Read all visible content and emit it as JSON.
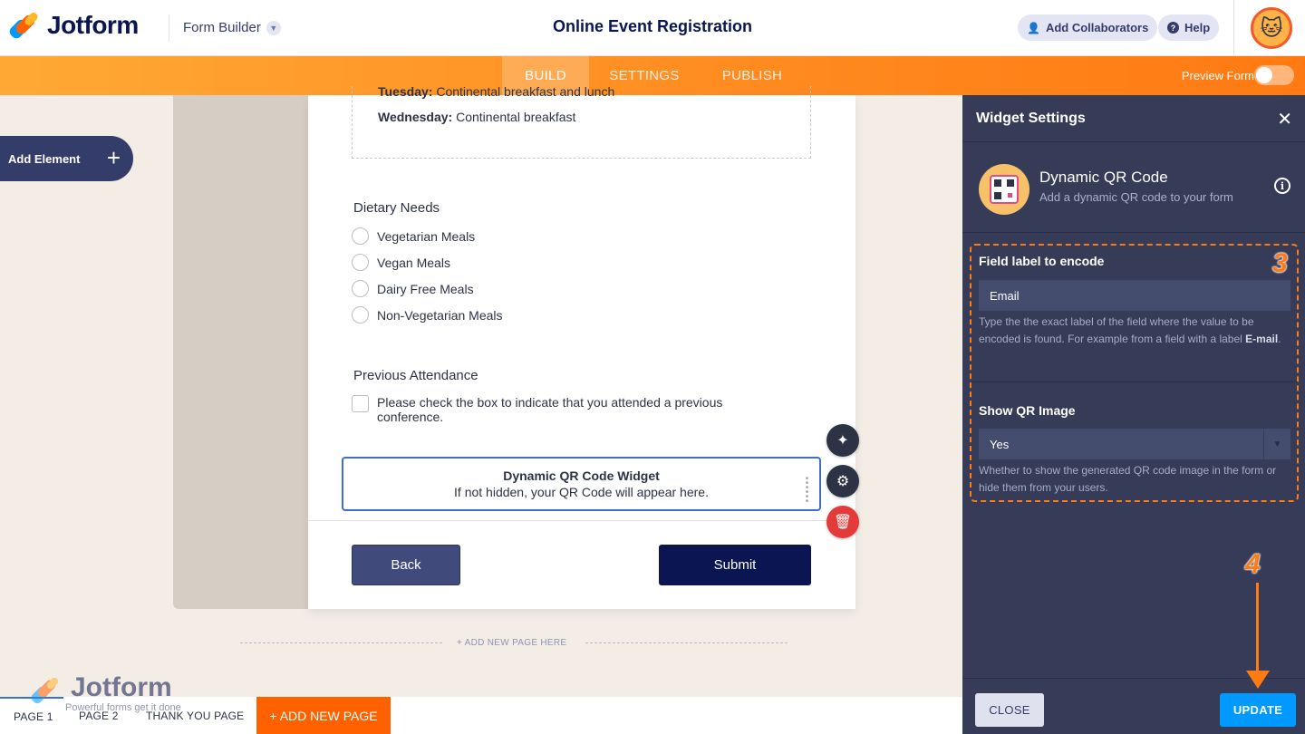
{
  "header": {
    "brand": "Jotform",
    "builder_label": "Form Builder",
    "page_title": "Online Event Registration",
    "add_collaborators": "Add Collaborators",
    "help": "Help"
  },
  "nav": {
    "tabs": [
      {
        "label": "BUILD",
        "active": true
      },
      {
        "label": "SETTINGS",
        "active": false
      },
      {
        "label": "PUBLISH",
        "active": false
      }
    ],
    "preview_label": "Preview Form",
    "preview_on": false
  },
  "sidebar": {
    "add_element": "Add Element"
  },
  "form": {
    "meals": [
      {
        "day": "Tuesday:",
        "text": "Continental breakfast and lunch"
      },
      {
        "day": "Wednesday:",
        "text": "Continental breakfast"
      }
    ],
    "dietary": {
      "label": "Dietary Needs",
      "options": [
        "Vegetarian Meals",
        "Vegan Meals",
        "Dairy Free Meals",
        "Non-Vegetarian Meals"
      ]
    },
    "attendance": {
      "label": "Previous Attendance",
      "checkbox_text": "Please check the box to indicate that you attended a previous conference."
    },
    "qr_widget": {
      "title": "Dynamic QR Code Widget",
      "subtitle": "If not hidden, your QR Code will appear here."
    },
    "back_label": "Back",
    "submit_label": "Submit",
    "add_page_here": "+ ADD NEW PAGE HERE"
  },
  "pages": {
    "tabs": [
      "PAGE 1",
      "PAGE 2",
      "THANK YOU PAGE"
    ],
    "add_new_page": "+ ADD NEW PAGE",
    "watermark_brand": "Jotform",
    "watermark_tagline": "Powerful forms get it done"
  },
  "panel": {
    "title": "Widget Settings",
    "widget_name": "Dynamic QR Code",
    "widget_desc": "Add a dynamic QR code to your form",
    "field1": {
      "label": "Field label to encode",
      "value": "Email",
      "help_before": "Type the the exact label of the field where the value to be encoded is found. For example from a field with a label ",
      "help_bold": "E-mail",
      "help_after": "."
    },
    "field2": {
      "label": "Show QR Image",
      "value": "Yes",
      "help": "Whether to show the generated QR code image in the form or hide them from your users."
    },
    "close_label": "CLOSE",
    "update_label": "UPDATE"
  },
  "annotations": {
    "step3": "3",
    "step4": "4"
  },
  "colors": {
    "brand_orange": "#ff7a12",
    "navy": "#0a1551",
    "panel_bg": "#363c57",
    "update_blue": "#0099ff"
  }
}
